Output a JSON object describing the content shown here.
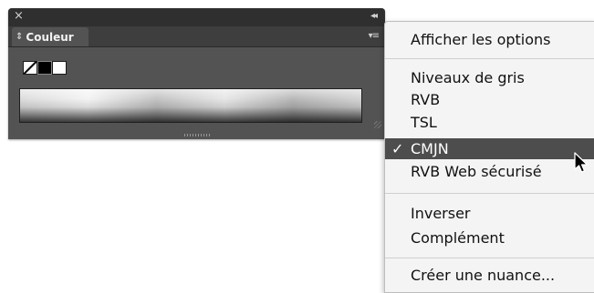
{
  "panel": {
    "tab_label": "Couleur",
    "icons": {
      "close": "close-icon",
      "collapse": "double-chevron-icon",
      "tab": "sort-arrows-icon",
      "menu": "panel-menu-icon",
      "none_swatch": "none-swatch-icon"
    },
    "ramp_colors": [
      "#ffffff",
      "#000000"
    ]
  },
  "menu": {
    "items": [
      {
        "label": "Afficher les options"
      },
      {
        "label": "Niveaux de gris"
      },
      {
        "label": "RVB"
      },
      {
        "label": "TSL"
      },
      {
        "label": "CMJN",
        "checked": true
      },
      {
        "label": "RVB Web sécurisé"
      },
      {
        "label": "Inverser"
      },
      {
        "label": "Complément"
      },
      {
        "label": "Créer une nuance..."
      }
    ],
    "check_glyph": "✓",
    "selected_bg": "#4d4d4d"
  }
}
